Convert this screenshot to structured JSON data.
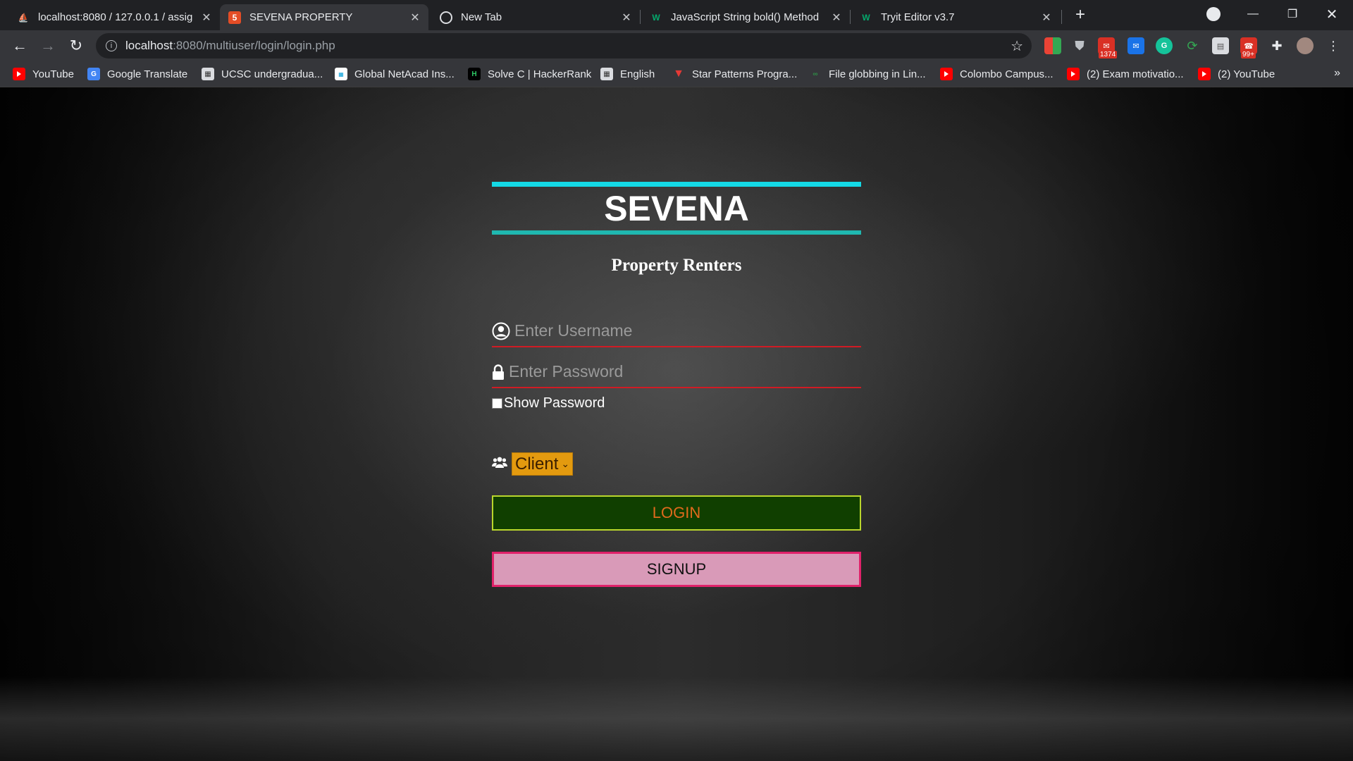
{
  "tabs": [
    {
      "label": "localhost:8080 / 127.0.0.1 / assig",
      "icon": "phpmyadmin-icon",
      "active": false
    },
    {
      "label": "SEVENA PROPERTY",
      "icon": "html5-icon",
      "active": true
    },
    {
      "label": "New Tab",
      "icon": "chrome-icon",
      "active": false
    },
    {
      "label": "JavaScript String bold() Method",
      "icon": "w3schools-icon",
      "active": false
    },
    {
      "label": "Tryit Editor v3.7",
      "icon": "w3schools-icon",
      "active": false
    }
  ],
  "address_bar": {
    "host": "localhost",
    "path": ":8080/multiuser/login/login.php"
  },
  "extensions": {
    "mail_badge": "1374",
    "ext_badge": "99+"
  },
  "bookmarks": [
    {
      "label": "YouTube",
      "icon": "youtube-icon"
    },
    {
      "label": "Google Translate",
      "icon": "google-translate-icon"
    },
    {
      "label": "UCSC undergradua...",
      "icon": "page-icon"
    },
    {
      "label": "Global NetAcad Ins...",
      "icon": "cisco-icon"
    },
    {
      "label": "Solve C | HackerRank",
      "icon": "hackerrank-icon"
    },
    {
      "label": "English",
      "icon": "page-icon"
    },
    {
      "label": "Star Patterns Progra...",
      "icon": "vue-icon"
    },
    {
      "label": "File globbing in Lin...",
      "icon": "geeks-icon"
    },
    {
      "label": "Colombo Campus...",
      "icon": "youtube-icon"
    },
    {
      "label": "(2) Exam motivatio...",
      "icon": "youtube-icon"
    },
    {
      "label": "(2) YouTube",
      "icon": "youtube-icon"
    }
  ],
  "login": {
    "brand": "SEVENA",
    "subtitle": "Property Renters",
    "username_placeholder": "Enter Username",
    "password_placeholder": "Enter Password",
    "show_password_label": "Show Password",
    "role_selected": "Client",
    "login_label": "LOGIN",
    "signup_label": "SIGNUP"
  },
  "colors": {
    "brand_line_top": "#14d9e6",
    "brand_line_bottom": "#1fb8b0",
    "field_underline": "#d01b24",
    "role_select": "#e39a0f",
    "login_bg": "#103f00",
    "login_border": "#b9d62c",
    "login_text": "#e06a1c",
    "signup_bg": "#d99ab8",
    "signup_border": "#e0226a"
  }
}
